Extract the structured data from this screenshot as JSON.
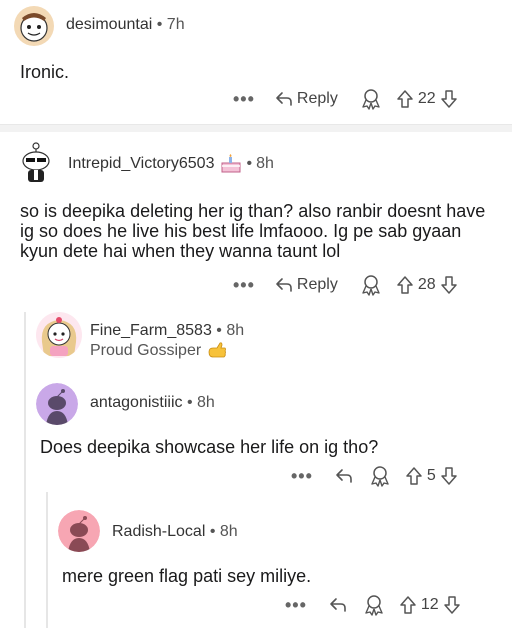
{
  "comments": [
    {
      "user": "desimountai",
      "time": "7h",
      "body": "Ironic.",
      "reply_label": "Reply",
      "votes": "22"
    },
    {
      "user": "Intrepid_Victory6503",
      "time": "8h",
      "body": "so is deepika deleting her ig than? also ranbir doesnt have ig so does he live his best life lmfaooo. Ig pe sab gyaan kyun dete hai when they wanna taunt lol",
      "reply_label": "Reply",
      "votes": "28",
      "badge_icon": "cake-icon"
    },
    {
      "user": "Fine_Farm_8583",
      "time": "8h",
      "flair": "Proud Gossiper",
      "flair_icon": "hand-pointing-emoji-icon"
    },
    {
      "user": "antagonistiiic",
      "time": "8h",
      "body": "Does deepika showcase her life on ig tho?",
      "votes": "5"
    },
    {
      "user": "Radish-Local",
      "time": "8h",
      "body": "mere green flag pati sey miliye.",
      "votes": "12"
    }
  ],
  "separator": "•",
  "more_glyph": "•••",
  "colors": {
    "accent_purple": "#c9a8e8",
    "accent_pink": "#f7a6b3"
  }
}
